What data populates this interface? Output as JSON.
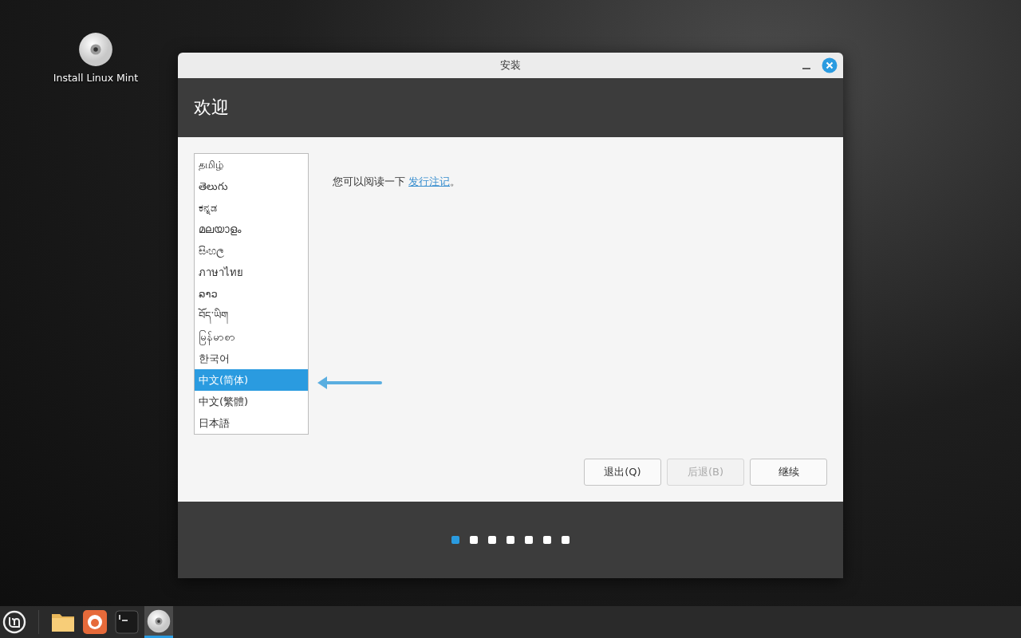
{
  "desktop": {
    "icons": [
      {
        "label": "Install Linux Mint"
      }
    ]
  },
  "window": {
    "title": "安装",
    "heading": "欢迎"
  },
  "languages": [
    {
      "label": "தமிழ்",
      "selected": false
    },
    {
      "label": "తెలుగు",
      "selected": false
    },
    {
      "label": "ಕನ್ನಡ",
      "selected": false
    },
    {
      "label": "മലയാളം",
      "selected": false
    },
    {
      "label": "සිංහල",
      "selected": false
    },
    {
      "label": "ภาษาไทย",
      "selected": false
    },
    {
      "label": "ລາວ",
      "selected": false
    },
    {
      "label": "བོད་ཡིག",
      "selected": false
    },
    {
      "label": "မြန်မာစာ",
      "selected": false
    },
    {
      "label": "한국어",
      "selected": false
    },
    {
      "label": "中文(简体)",
      "selected": true
    },
    {
      "label": "中文(繁體)",
      "selected": false
    },
    {
      "label": "日本語",
      "selected": false
    }
  ],
  "intro": {
    "text": "您可以阅读一下",
    "link": "发行注记",
    "end": "。"
  },
  "buttons": [
    {
      "label": "退出(Q)",
      "disabled": false
    },
    {
      "label": "后退(B)",
      "disabled": true
    },
    {
      "label": "继续",
      "disabled": false
    }
  ],
  "steps": [
    {
      "selected": true
    },
    {
      "selected": false
    },
    {
      "selected": false
    },
    {
      "selected": false
    },
    {
      "selected": false
    },
    {
      "selected": false
    },
    {
      "selected": false
    }
  ],
  "taskbar": {
    "items": [
      {
        "kind": "menu",
        "active": false
      },
      {
        "kind": "folder",
        "active": false
      },
      {
        "kind": "browser",
        "active": false
      },
      {
        "kind": "terminal",
        "active": false
      },
      {
        "kind": "disc",
        "active": true
      }
    ]
  }
}
